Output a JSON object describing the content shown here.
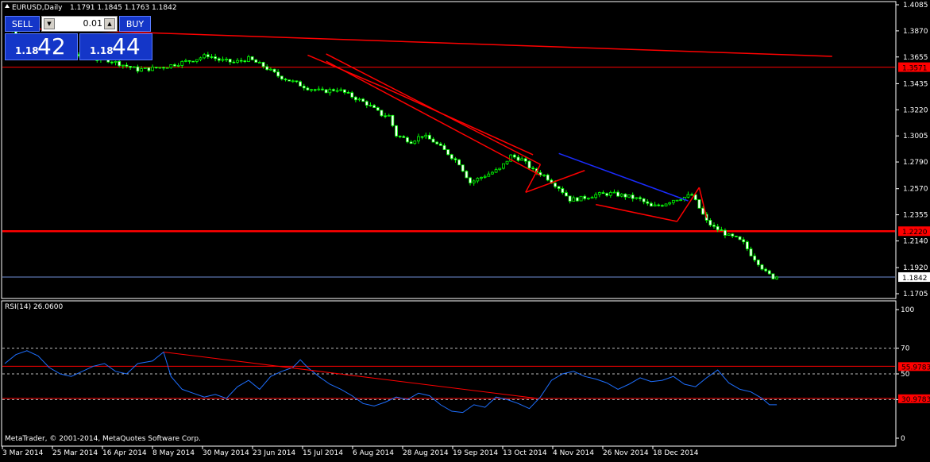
{
  "chart_title": "EURUSD,Daily",
  "ohlc_text": "1.1791 1.1845 1.1763 1.1842",
  "copyright": "MetaTrader, © 2001-2014, MetaQuotes Software Corp.",
  "rsi_label": "RSI(14) 26.0600",
  "trade_panel": {
    "sell_label": "SELL",
    "buy_label": "BUY",
    "lot_value": "0.01",
    "sell_prefix": "1.18",
    "sell_big": "42",
    "buy_prefix": "1.18",
    "buy_big": "44"
  },
  "colors": {
    "candle": "#00ff00",
    "trend": "#ff0000",
    "trend_blue": "#1a2cff",
    "rsi_line": "#1e6fff",
    "bid_line": "#6f8fd8"
  },
  "chart_data": [
    {
      "type": "candlestick",
      "symbol": "EURUSD",
      "timeframe": "Daily",
      "ylim": [
        1.1705,
        1.4085
      ],
      "y_ticks": [
        1.4085,
        1.387,
        1.3655,
        1.3435,
        1.322,
        1.3005,
        1.279,
        1.257,
        1.2355,
        1.214,
        1.192,
        1.1705
      ],
      "x_tick_labels": [
        "3 Mar 2014",
        "25 Mar 2014",
        "16 Apr 2014",
        "8 May 2014",
        "30 May 2014",
        "23 Jun 2014",
        "15 Jul 2014",
        "6 Aug 2014",
        "28 Aug 2014",
        "19 Sep 2014",
        "13 Oct 2014",
        "4 Nov 2014",
        "26 Nov 2014",
        "18 Dec 2014"
      ],
      "x_domain": [
        0,
        215
      ],
      "close_path": [
        [
          1,
          1.39
        ],
        [
          4,
          1.384
        ],
        [
          8,
          1.377
        ],
        [
          12,
          1.372
        ],
        [
          16,
          1.37
        ],
        [
          20,
          1.367
        ],
        [
          24,
          1.364
        ],
        [
          28,
          1.363
        ],
        [
          32,
          1.359
        ],
        [
          36,
          1.355
        ],
        [
          40,
          1.356
        ],
        [
          44,
          1.358
        ],
        [
          48,
          1.361
        ],
        [
          52,
          1.364
        ],
        [
          55,
          1.367
        ],
        [
          58,
          1.363
        ],
        [
          62,
          1.361
        ],
        [
          66,
          1.364
        ],
        [
          70,
          1.358
        ],
        [
          74,
          1.35
        ],
        [
          78,
          1.345
        ],
        [
          82,
          1.34
        ],
        [
          86,
          1.337
        ],
        [
          90,
          1.339
        ],
        [
          94,
          1.333
        ],
        [
          98,
          1.327
        ],
        [
          102,
          1.318
        ],
        [
          104,
          1.317
        ],
        [
          106,
          1.301
        ],
        [
          110,
          1.296
        ],
        [
          113,
          1.301
        ],
        [
          116,
          1.296
        ],
        [
          120,
          1.286
        ],
        [
          123,
          1.278
        ],
        [
          126,
          1.262
        ],
        [
          130,
          1.268
        ],
        [
          134,
          1.273
        ],
        [
          137,
          1.284
        ],
        [
          140,
          1.281
        ],
        [
          143,
          1.272
        ],
        [
          146,
          1.268
        ],
        [
          150,
          1.258
        ],
        [
          153,
          1.248
        ],
        [
          156,
          1.249
        ],
        [
          160,
          1.252
        ],
        [
          164,
          1.253
        ],
        [
          168,
          1.251
        ],
        [
          172,
          1.248
        ],
        [
          175,
          1.242
        ],
        [
          178,
          1.244
        ],
        [
          181,
          1.248
        ],
        [
          184,
          1.25
        ],
        [
          186,
          1.252
        ],
        [
          188,
          1.241
        ],
        [
          190,
          1.23
        ],
        [
          192,
          1.225
        ],
        [
          194,
          1.222
        ],
        [
          196,
          1.218
        ],
        [
          198,
          1.216
        ],
        [
          200,
          1.212
        ],
        [
          202,
          1.203
        ],
        [
          204,
          1.196
        ],
        [
          206,
          1.188
        ],
        [
          208,
          1.184
        ],
        [
          209,
          1.1842
        ]
      ],
      "horizontal_levels": [
        {
          "value": 1.3571,
          "label": "1.3571",
          "style": "thin-red"
        },
        {
          "value": 1.222,
          "label": "1.2220",
          "style": "thick-red"
        },
        {
          "value": 1.1842,
          "label": "1.1842",
          "style": "bid"
        }
      ],
      "trendlines": [
        {
          "color": "red",
          "points": [
            [
              0,
              1.3895
            ],
            [
              224,
              1.366
            ]
          ]
        },
        {
          "color": "red",
          "points": [
            [
              87,
              1.368
            ],
            [
              145,
              1.277
            ]
          ]
        },
        {
          "color": "red",
          "points": [
            [
              87,
              1.362
            ],
            [
              145,
              1.268
            ]
          ]
        },
        {
          "color": "red",
          "points": [
            [
              103,
              1.34
            ],
            [
              143,
              1.285
            ]
          ]
        },
        {
          "color": "red",
          "points": [
            [
              82,
              1.367
            ],
            [
              103,
              1.34
            ]
          ]
        },
        {
          "color": "red",
          "points": [
            [
              141,
              1.254
            ],
            [
              145,
              1.277
            ]
          ]
        },
        {
          "color": "red",
          "points": [
            [
              141,
              1.254
            ],
            [
              157,
              1.272
            ]
          ]
        },
        {
          "color": "blue",
          "points": [
            [
              150,
              1.286
            ],
            [
              185,
              1.247
            ]
          ]
        },
        {
          "color": "red",
          "points": [
            [
              160,
              1.244
            ],
            [
              182,
              1.23
            ]
          ]
        },
        {
          "color": "red",
          "points": [
            [
              182,
              1.23
            ],
            [
              188,
              1.258
            ]
          ]
        },
        {
          "color": "red",
          "points": [
            [
              188,
              1.258
            ],
            [
              190,
              1.233
            ]
          ]
        }
      ]
    },
    {
      "type": "line",
      "name": "RSI(14)",
      "current_value": 26.06,
      "ylim": [
        0,
        100
      ],
      "y_ticks": [
        100,
        70,
        50,
        30,
        0
      ],
      "dashed_levels": [
        70,
        50,
        30
      ],
      "levels": [
        {
          "value": 55.9783,
          "label": "55.9783"
        },
        {
          "value": 30.9783,
          "label": "30.9783"
        }
      ],
      "trendlines": [
        {
          "color": "red",
          "points": [
            [
              43,
              67
            ],
            [
              144,
              31
            ]
          ]
        }
      ],
      "values_path": [
        [
          0,
          58
        ],
        [
          3,
          65
        ],
        [
          6,
          68
        ],
        [
          9,
          64
        ],
        [
          12,
          55
        ],
        [
          15,
          50
        ],
        [
          18,
          48
        ],
        [
          21,
          52
        ],
        [
          24,
          56
        ],
        [
          27,
          58
        ],
        [
          30,
          52
        ],
        [
          33,
          50
        ],
        [
          36,
          58
        ],
        [
          40,
          60
        ],
        [
          43,
          67
        ],
        [
          45,
          48
        ],
        [
          48,
          38
        ],
        [
          51,
          35
        ],
        [
          54,
          32
        ],
        [
          57,
          34
        ],
        [
          60,
          31
        ],
        [
          63,
          40
        ],
        [
          66,
          45
        ],
        [
          69,
          38
        ],
        [
          72,
          48
        ],
        [
          75,
          52
        ],
        [
          78,
          55
        ],
        [
          80,
          61
        ],
        [
          82,
          55
        ],
        [
          85,
          48
        ],
        [
          88,
          42
        ],
        [
          91,
          38
        ],
        [
          94,
          33
        ],
        [
          97,
          27
        ],
        [
          100,
          25
        ],
        [
          103,
          28
        ],
        [
          106,
          32
        ],
        [
          109,
          30
        ],
        [
          112,
          35
        ],
        [
          115,
          33
        ],
        [
          118,
          26
        ],
        [
          121,
          21
        ],
        [
          124,
          20
        ],
        [
          127,
          26
        ],
        [
          130,
          24
        ],
        [
          133,
          32
        ],
        [
          136,
          30
        ],
        [
          139,
          27
        ],
        [
          142,
          23
        ],
        [
          145,
          32
        ],
        [
          148,
          45
        ],
        [
          151,
          50
        ],
        [
          154,
          52
        ],
        [
          157,
          48
        ],
        [
          160,
          46
        ],
        [
          163,
          43
        ],
        [
          166,
          38
        ],
        [
          169,
          42
        ],
        [
          172,
          47
        ],
        [
          175,
          44
        ],
        [
          178,
          45
        ],
        [
          181,
          48
        ],
        [
          184,
          42
        ],
        [
          187,
          40
        ],
        [
          190,
          47
        ],
        [
          193,
          53
        ],
        [
          196,
          43
        ],
        [
          199,
          38
        ],
        [
          202,
          36
        ],
        [
          205,
          31
        ],
        [
          207,
          26
        ],
        [
          209,
          26
        ]
      ]
    }
  ]
}
